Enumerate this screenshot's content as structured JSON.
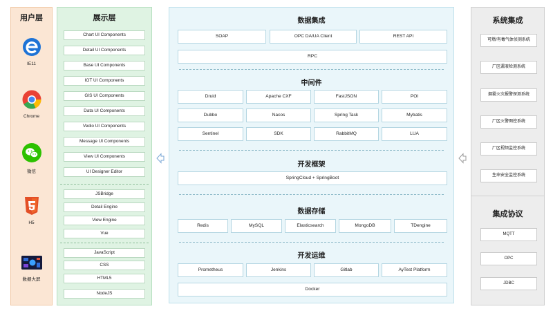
{
  "user_layer": {
    "title": "用户层",
    "items": [
      {
        "label": "IE11",
        "icon": "ie-icon"
      },
      {
        "label": "Chrome",
        "icon": "chrome-icon"
      },
      {
        "label": "微信",
        "icon": "wechat-icon"
      },
      {
        "label": "H5",
        "icon": "html5-icon"
      },
      {
        "label": "数据大屏",
        "icon": "dashboard-icon"
      }
    ]
  },
  "display_layer": {
    "title": "展示层",
    "group1": [
      "Chart UI Components",
      "Detail UI Components",
      "Base UI Components",
      "IOT UI Components",
      "GIS UI Components",
      "Data UI Components",
      "Vedio UI Components",
      "Message UI Components",
      "View UI Components",
      "UI Designer Editor"
    ],
    "group2": [
      "JSBridge",
      "Detail Engine",
      "View Engine",
      "Vue"
    ],
    "group3": [
      "JavaScript",
      "CSS",
      "HTML5",
      "NodeJS"
    ]
  },
  "data_integration": {
    "title": "数据集成",
    "row1": [
      "SOAP",
      "OPC DA/UA Client",
      "REST API"
    ],
    "rpc": "RPC"
  },
  "middleware": {
    "title": "中间件",
    "rows": [
      [
        "Druid",
        "Apache CXF",
        "FastJSON",
        "POI"
      ],
      [
        "Dubbo",
        "Nacos",
        "Spring Task",
        "Mybatis"
      ],
      [
        "Sentinel",
        "SDK",
        "RabbitMQ",
        "LUA"
      ]
    ]
  },
  "dev_framework": {
    "title": "开发框架",
    "item": "SpringCloud + SpringBoot"
  },
  "data_storage": {
    "title": "数据存储",
    "items": [
      "Redis",
      "MySQL",
      "Elasticsearch",
      "MongoDB",
      "TDengine"
    ]
  },
  "devops": {
    "title": "开发运维",
    "row1": [
      "Prometheus",
      "Jenkins",
      "Gitlab",
      "AyTest Platform"
    ],
    "docker": "Docker"
  },
  "system_integration": {
    "title": "系统集成",
    "items": [
      "可燃/有毒气体侦测系统",
      "厂区漏液检测系统",
      "烟雾火灾报警探测系统",
      "厂区火警图控系统",
      "厂区视频监控系统",
      "生命安全监控系统"
    ]
  },
  "protocols": {
    "title": "集成协议",
    "items": [
      "MQTT",
      "OPC",
      "JDBC"
    ]
  },
  "colors": {
    "user_bg": "#fbe6d4",
    "display_bg": "#dff3e3",
    "center_bg": "#eaf6fa",
    "system_bg": "#ededed"
  }
}
